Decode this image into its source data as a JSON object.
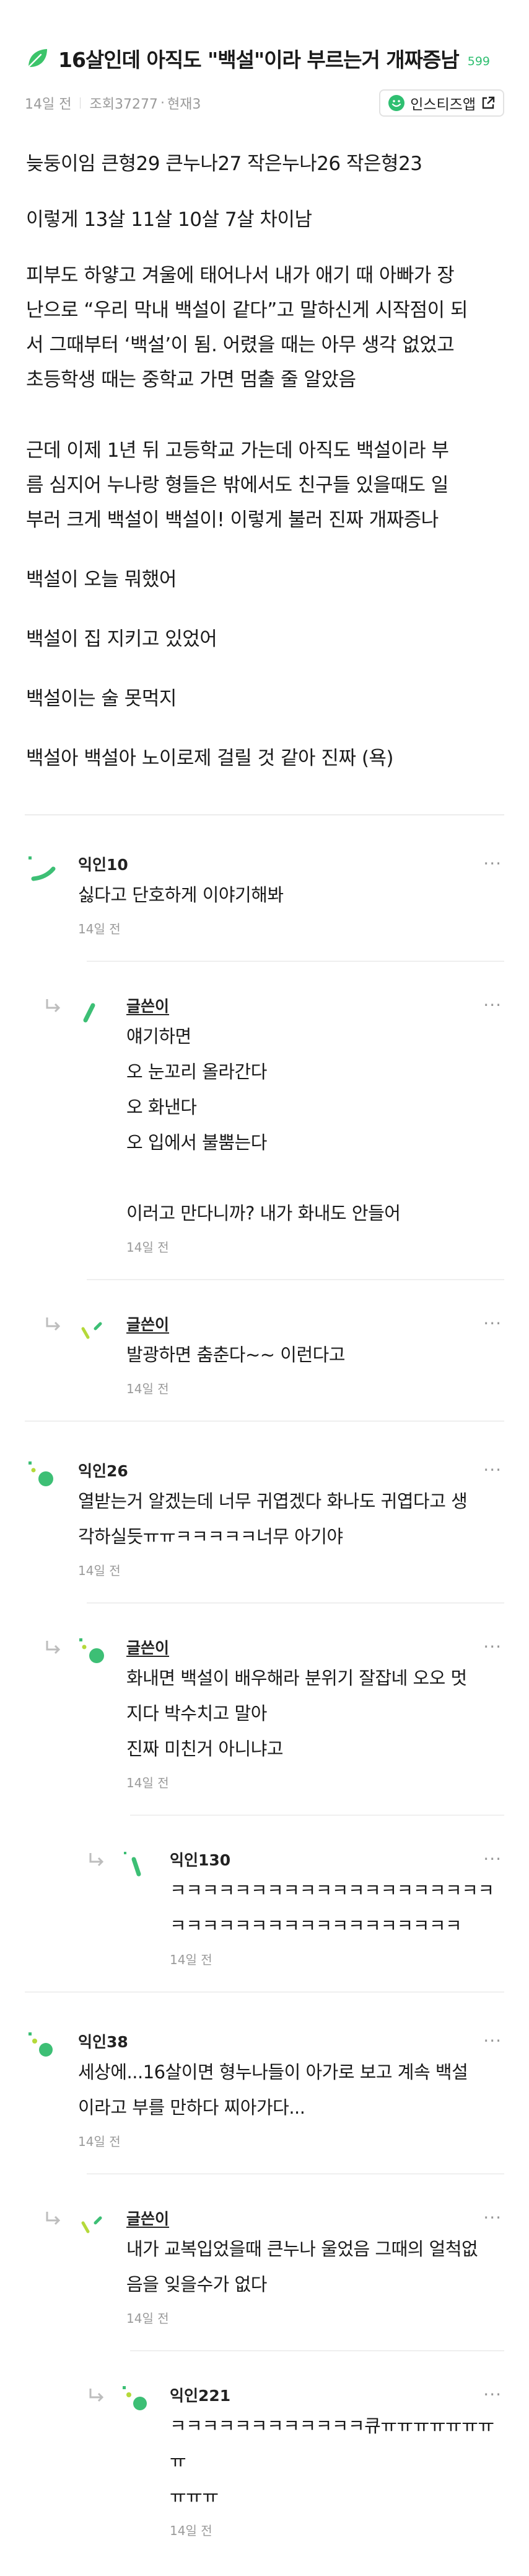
{
  "post": {
    "title": "16살인데 아직도 \"백설\"이라 부르는거 개짜증남",
    "title_count": "599",
    "meta": {
      "time": "14일 전",
      "views": "조회37277",
      "current": "현재3"
    },
    "app_button": "인스티즈앱",
    "body": [
      "늦둥이임 큰형29 큰누나27 작은누나26 작은형23",
      "이렇게 13살 11살 10살 7살 차이남",
      "피부도 하얗고 겨울에 태어나서 내가 애기 때 아빠가 장",
      "난으로 “우리 막내 백설이 같다”고 말하신게 시작점이 되",
      "서 그때부터 ‘백설’이 됨. 어렸을 때는 아무 생각 없었고",
      "초등학생 때는 중학교 가면 멈출 줄 알았음",
      "근데 이제 1년 뒤 고등학교 가는데 아직도 백설이라 부",
      "름 심지어 누나랑 형들은 밖에서도 친구들 있을때도 일",
      "부러 크게 백설이 백설이! 이렇게 불러 진짜 개짜증나",
      "백설이 오늘 뭐했어",
      "백설이 집 지키고 있었어",
      "백설이는 술 못먹지",
      "백설아 백설아 노이로제 걸릴 것 같아 진짜 (욕)"
    ]
  },
  "comments": [
    {
      "name": "익인10",
      "lines": [
        "싫다고 단호하게 이야기해봐"
      ],
      "time": "14일 전"
    },
    {
      "name": "글쓴이",
      "lines": [
        "얘기하면",
        "오 눈꼬리 올라간다",
        "오 화낸다",
        "오 입에서 불뿜는다",
        "",
        "이러고 만다니까? 내가 화내도 안들어"
      ],
      "time": "14일 전"
    },
    {
      "name": "글쓴이",
      "lines": [
        "발광하면 춤춘다~~ 이런다고"
      ],
      "time": "14일 전"
    },
    {
      "name": "익인26",
      "lines": [
        "열받는거 알겠는데 너무 귀엽겠다 화나도 귀엽다고 생",
        "각하실듯ㅠㅠㅋㅋㅋㅋㅋ너무 아기야"
      ],
      "time": "14일 전"
    },
    {
      "name": "글쓴이",
      "lines": [
        "화내면 백설이 배우해라 분위기 잘잡네 오오 멋",
        "지다 박수치고 말아",
        "진짜 미친거 아니냐고"
      ],
      "time": "14일 전"
    },
    {
      "name": "익인130",
      "lines": [
        "ㅋㅋㅋㅋㅋㅋㅋㅋㅋㅋㅋㅋㅋㅋㅋㅋㅋㅋㅋㅋ",
        "ㅋㅋㅋㅋㅋㅋㅋㅋㅋㅋㅋㅋㅋㅋㅋㅋㅋㅋ"
      ],
      "time": "14일 전"
    },
    {
      "name": "익인38",
      "lines": [
        "세상에...16살이면 형누나들이 아가로 보고 계속 백설",
        "이라고 부를 만하다 찌아가다..."
      ],
      "time": "14일 전"
    },
    {
      "name": "글쓴이",
      "lines": [
        "내가 교복입었을때 큰누나 울었음 그때의 얼척없",
        "음을 잊을수가 없다"
      ],
      "time": "14일 전"
    },
    {
      "name": "익인221",
      "lines": [
        "ㅋㅋㅋㅋㅋㅋㅋㅋㅋㅋㅋㅋ큐ㅠㅠㅠㅠㅠㅠㅠㅠ",
        "ㅠㅠㅠ"
      ],
      "time": "14일 전"
    }
  ],
  "colors": {
    "accent_green": "#2fbf71",
    "avatar_green": "#3dbf75",
    "avatar_lime": "#b5d93a",
    "muted": "#9a9a9a"
  },
  "icons": {
    "title": "leaf-icon",
    "app": "smile-icon",
    "external": "external-link-icon",
    "reply": "reply-arrow-icon",
    "more": "more-dots-icon"
  }
}
